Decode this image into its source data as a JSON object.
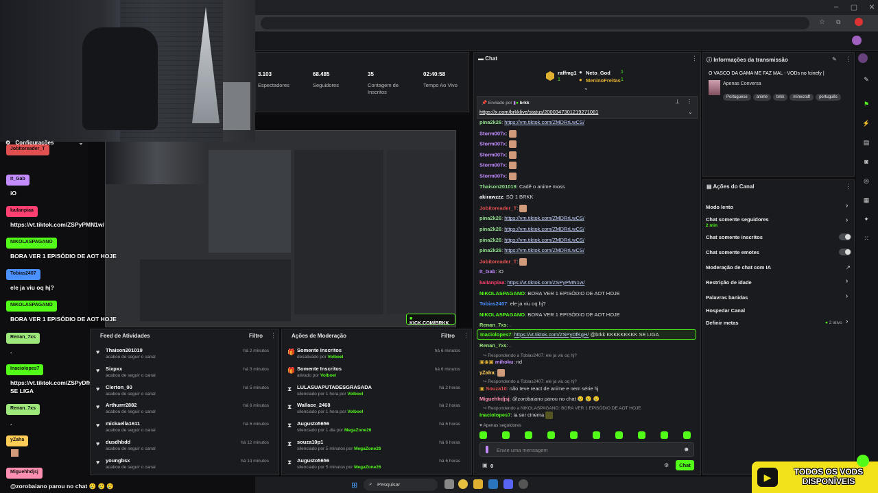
{
  "stats": [
    {
      "value": "3.103",
      "label": "Espectadores"
    },
    {
      "value": "68.485",
      "label": "Seguidores"
    },
    {
      "value": "35",
      "label": "Contagem de Inscritos"
    },
    {
      "value": "02:40:58",
      "label": "Tempo Ao Vivo"
    }
  ],
  "overlay": {
    "settings_label": "Configurações",
    "messages": [
      {
        "user": "Jobitoreader_T",
        "color": "#e05050",
        "text": ""
      },
      {
        "user": "It_Gab",
        "color": "#c38cff",
        "text": "iO"
      },
      {
        "user": "kaiIanpiaa",
        "color": "#ff4070",
        "text": "https://vt.tiktok.com/ZSPyPMN1w/"
      },
      {
        "user": "NIKOLASPAGANO",
        "color": "#53fc18",
        "text": "BORA VER 1 EPISÓDIO DE AOT HOJE"
      },
      {
        "user": "Tobias2407",
        "color": "#4a90ff",
        "text": "ele ja viu oq hj?"
      },
      {
        "user": "NIKOLASPAGANO",
        "color": "#53fc18",
        "text": "BORA VER 1 EPISÓDIO DE AOT HOJE"
      },
      {
        "user": "Renan_7xs",
        "color": "#9de87a",
        "text": "."
      },
      {
        "user": "Inaciolopes7",
        "color": "#53fc18",
        "text": "https://vt.tiktok.com/ZSPyDfKgH/ @brkk KKKKKKKKK SE LIGA"
      },
      {
        "user": "Renan_7xs",
        "color": "#9de87a",
        "text": "."
      },
      {
        "user": "yZaha",
        "color": "#ffcc55",
        "text": ""
      },
      {
        "user": "Miguehhdjsj",
        "color": "#ff8fb0",
        "text": "@zorobaiano parou no chat 😢 😢 😢"
      }
    ]
  },
  "kick_overlay": "KICK.COM/BRKK",
  "feed": {
    "title": "Feed de Atividades",
    "filter": "Filtro",
    "items": [
      {
        "name": "Thaison201019",
        "sub": "acabou de seguir o canal",
        "time": "há 2 minutos"
      },
      {
        "name": "Sixpxx",
        "sub": "acabou de seguir o canal",
        "time": "há 3 minutos"
      },
      {
        "name": "Clerton_00",
        "sub": "acabou de seguir o canal",
        "time": "há 5 minutos"
      },
      {
        "name": "Arthurrr2882",
        "sub": "acabou de seguir o canal",
        "time": "há 6 minutos"
      },
      {
        "name": "mickaella1611",
        "sub": "acabou de seguir o canal",
        "time": "há 6 minutos"
      },
      {
        "name": "dusdhbdd",
        "sub": "acabou de seguir o canal",
        "time": "há 12 minutos"
      },
      {
        "name": "youngbsx",
        "sub": "acabou de seguir o canal",
        "time": "há 14 minutos"
      }
    ]
  },
  "mod": {
    "title": "Ações de Moderação",
    "filter": "Filtro",
    "items": [
      {
        "name": "Somente Inscritos",
        "sub": "desativado por ",
        "by": "Volboel",
        "time": "há 6 minutos"
      },
      {
        "name": "Somente Inscritos",
        "sub": "ativado por ",
        "by": "Volboel",
        "time": "há 6 minutos"
      },
      {
        "name": "LULASUAPUTADESGRASADA",
        "sub": "silenciado por 1 hora por ",
        "by": "Volboel",
        "time": "há 2 horas"
      },
      {
        "name": "Wallace_2468",
        "sub": "silenciado por 1 hora por ",
        "by": "Volboel",
        "time": "há 2 horas"
      },
      {
        "name": "Augusto5656",
        "sub": "silenciado por 1 dia por ",
        "by": "MegaZone26",
        "time": "há 6 horas"
      },
      {
        "name": "souza10p1",
        "sub": "silenciado por 5 minutos por ",
        "by": "MegaZone26",
        "time": "há 6 horas"
      },
      {
        "name": "Augusto5656",
        "sub": "silenciado por 5 minutos por ",
        "by": "MegaZone26",
        "time": "há 6 horas"
      }
    ]
  },
  "chat": {
    "title": "Chat",
    "leaders": [
      {
        "name": "raffmg1",
        "count": "1"
      },
      {
        "name": "Neto_God",
        "count": "1"
      },
      {
        "name": "MeninoFreitas",
        "count": "1"
      }
    ],
    "pinned_by": "Enviado por",
    "pinned_user": "brkk",
    "pinned_link": "https://x.com/brkklive/status/2000347301219271081",
    "messages": [
      {
        "user": "pina2k26",
        "color": "#8fe08a",
        "text": "https://vm.tiktok.com/ZMDRrLwCS/",
        "link": true
      },
      {
        "user": "Storm007x",
        "color": "#c38cff",
        "text": "",
        "emote": true
      },
      {
        "user": "Storm007x",
        "color": "#c38cff",
        "text": "",
        "emote": true
      },
      {
        "user": "Storm007x",
        "color": "#c38cff",
        "text": "",
        "emote": true
      },
      {
        "user": "Storm007x",
        "color": "#c38cff",
        "text": "",
        "emote": true
      },
      {
        "user": "Storm007x",
        "color": "#c38cff",
        "text": "",
        "emote": true
      },
      {
        "user": "Thaison201019",
        "color": "#8fe08a",
        "text": "Cadê o anime moss"
      },
      {
        "user": "akirawzzz",
        "color": "#ffffff",
        "text": "SÓ 1 BRKK"
      },
      {
        "user": "Jobitoreader_T",
        "color": "#e05050",
        "text": "",
        "emote": true
      },
      {
        "user": "pina2k26",
        "color": "#8fe08a",
        "text": "https://vm.tiktok.com/ZMDRrLwCS/",
        "link": true
      },
      {
        "user": "pina2k26",
        "color": "#8fe08a",
        "text": "https://vm.tiktok.com/ZMDRrLwCS/",
        "link": true
      },
      {
        "user": "pina2k26",
        "color": "#8fe08a",
        "text": "https://vm.tiktok.com/ZMDRrLwCS/",
        "link": true
      },
      {
        "user": "pina2k26",
        "color": "#8fe08a",
        "text": "https://vm.tiktok.com/ZMDRrLwCS/",
        "link": true
      },
      {
        "user": "Jobitoreader_T",
        "color": "#e05050",
        "text": "",
        "emote": true
      },
      {
        "user": "It_Gab",
        "color": "#c38cff",
        "text": "iO"
      },
      {
        "user": "kaiIanpiaa",
        "color": "#ff4070",
        "text": "https://vt.tiktok.com/ZSPyPMN1w/",
        "link": true
      },
      {
        "user": "NIKOLASPAGANO",
        "color": "#53fc18",
        "text": "BORA VER 1 EPISÓDIO DE AOT HOJE"
      },
      {
        "user": "Tobias2407",
        "color": "#4a90ff",
        "text": "ele ja viu oq hj?"
      },
      {
        "user": "NIKOLASPAGANO",
        "color": "#53fc18",
        "text": "BORA VER 1 EPISÓDIO DE AOT HOJE"
      },
      {
        "user": "Renan_7xs",
        "color": "#9de87a",
        "text": "."
      }
    ],
    "highlight": {
      "user": "Inaciolopes7",
      "text": "https://vt.tiktok.com/ZSPyDfKgH/",
      "tail": " @brkk KKKKKKKKK SE LIGA"
    },
    "after": [
      {
        "user": "Renan_7xs",
        "color": "#9de87a",
        "text": "."
      }
    ],
    "reply1": "Respondendo a Tobias2407: ele ja viu oq hj?",
    "r1_user": "mihoku",
    "r1_text": "nd",
    "yzaha": "yZaha",
    "reply2": "Respondendo a Tobias2407: ele ja viu oq hj?",
    "r2_user": "Souza10",
    "r2_text": "não teve react de anime e nem série hj",
    "migue_user": "Miguehhdjsj",
    "migue_text": "@zorobaiano parou no chat 😢 😢 😢",
    "reply3": "Respondendo a NIKOLASPAGANO: BORA VER 1 EPISÓDIO DE AOT HOJE",
    "r3_user": "Inaciolopes7",
    "r3_text": "ia ser cinema",
    "followers_only": "Apenas seguidores",
    "placeholder": "Envie uma mensagem",
    "count": "0",
    "send": "Chat"
  },
  "info": {
    "title": "Informações da transmissão",
    "stream_title": "O VASCO DA GAMA ME FAZ MAL - VODs no !cinefy |",
    "category": "Apenas Conversa",
    "tags": [
      "Portuguese",
      "anime",
      "brkk",
      "minecraft",
      "português"
    ]
  },
  "actions": {
    "title": "Ações do Canal",
    "items": [
      {
        "label": "Modo lento",
        "kind": "chev"
      },
      {
        "label": "Chat somente seguidores",
        "sub": "2 min",
        "kind": "chev"
      },
      {
        "label": "Chat somente inscritos",
        "kind": "toggle"
      },
      {
        "label": "Chat somente emotes",
        "kind": "toggle"
      },
      {
        "label": "Moderação de chat com IA",
        "kind": "ext"
      },
      {
        "label": "Restrição de idade",
        "kind": "chev"
      },
      {
        "label": "Palavras banidas",
        "kind": "chev"
      },
      {
        "label": "Hospedar Canal",
        "kind": "none"
      },
      {
        "label": "Definir metas",
        "badge": "2 ativo",
        "kind": "chev"
      }
    ]
  },
  "banner": "TODOS OS VODS DISPONÍVEIS",
  "taskbar": {
    "search": "Pesquisar"
  }
}
